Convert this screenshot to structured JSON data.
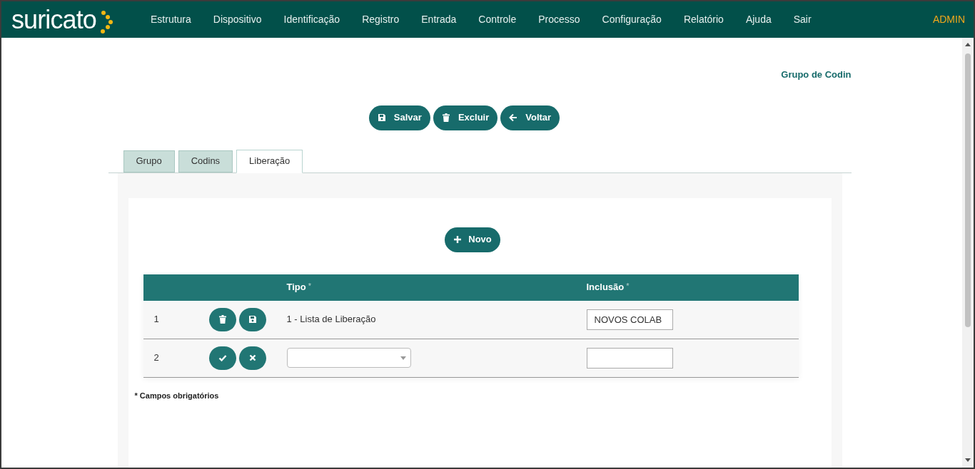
{
  "brand": "suricato",
  "menu": [
    {
      "label": "Estrutura"
    },
    {
      "label": "Dispositivo"
    },
    {
      "label": "Identificação"
    },
    {
      "label": "Registro"
    },
    {
      "label": "Entrada"
    },
    {
      "label": "Controle"
    },
    {
      "label": "Processo"
    },
    {
      "label": "Configuração"
    },
    {
      "label": "Relatório"
    },
    {
      "label": "Ajuda"
    },
    {
      "label": "Sair"
    }
  ],
  "user": "ADMIN",
  "page_title": "Grupo de Codin",
  "actions": [
    {
      "kind": "save",
      "label": "Salvar"
    },
    {
      "kind": "delete",
      "label": "Excluir"
    },
    {
      "kind": "back",
      "label": "Voltar"
    }
  ],
  "tabs": [
    {
      "label": "Grupo",
      "selected": false
    },
    {
      "label": "Codins",
      "selected": false
    },
    {
      "label": "Liberação",
      "selected": true
    }
  ],
  "new_button": "Novo",
  "table": {
    "columns": [
      {
        "label": "Tipo",
        "mark": "*"
      },
      {
        "label": "Inclusão",
        "mark": "*"
      }
    ],
    "rows": [
      {
        "kind": "saved",
        "number": "1",
        "tipo": "1 - Lista de Liberação",
        "inclusao": "NOVOS COLAB"
      },
      {
        "kind": "new",
        "number": "2",
        "tipo": "",
        "inclusao": ""
      }
    ]
  },
  "footnote": "* Campos obrigatórios"
}
